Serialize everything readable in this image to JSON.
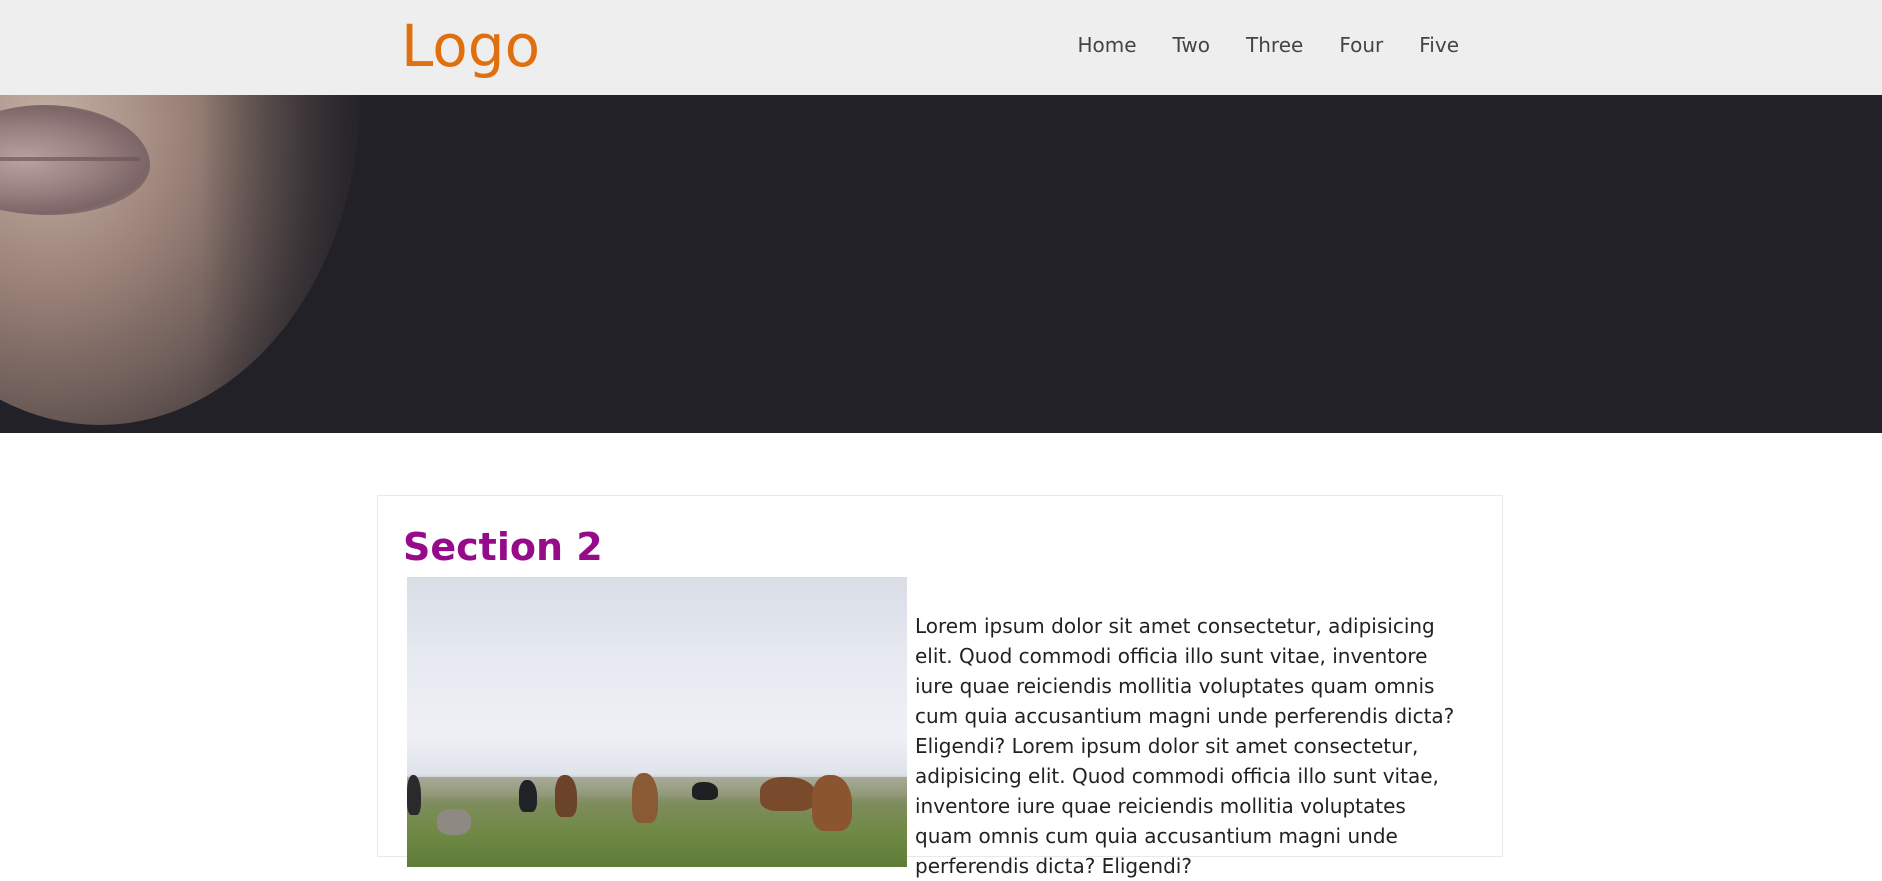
{
  "header": {
    "logo": "Logo",
    "nav": [
      "Home",
      "Two",
      "Three",
      "Four",
      "Five"
    ]
  },
  "hero": {
    "image_subject": "close-up face portrait"
  },
  "section": {
    "title": "Section 2",
    "image_subject": "horses grazing in a grassy field",
    "paragraph": "Lorem ipsum dolor sit amet consectetur, adipisicing elit. Quod commodi officia illo sunt vitae, inventore iure quae reiciendis mollitia voluptates quam omnis cum quia accusantium magni unde perferendis dicta? Eligendi? Lorem ipsum dolor sit amet consectetur, adipisicing elit. Quod commodi officia illo sunt vitae, inventore iure quae reiciendis mollitia voluptates quam omnis cum quia accusantium magni unde perferendis dicta? Eligendi?"
  },
  "colors": {
    "logo": "#e06f0d",
    "section_title": "#960b8a",
    "header_bg": "#eeeeee",
    "hero_bg": "#222127"
  }
}
